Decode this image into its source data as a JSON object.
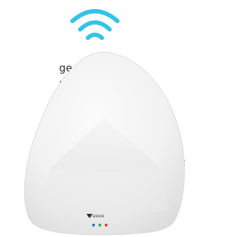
{
  "content": {
    "text_fragment_1": "ge.",
    "text_fragment_2": "pen",
    "text_fragment_3": ":"
  },
  "device": {
    "brand_label": "Paxton",
    "led_colors": [
      "#2f6fd6",
      "#2fa84f",
      "#d63a3a"
    ]
  },
  "wifi_color": "#34c3e8"
}
